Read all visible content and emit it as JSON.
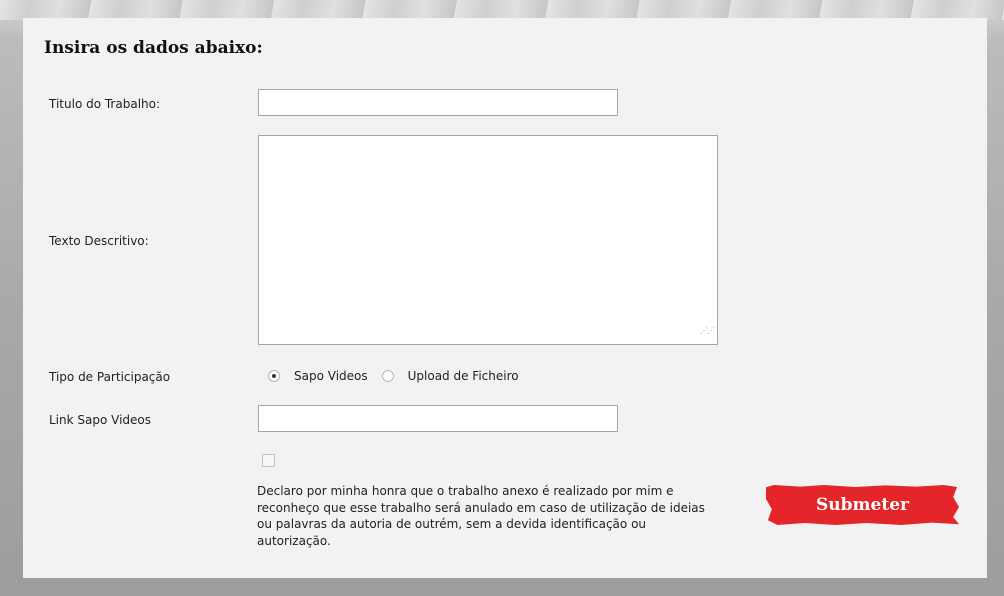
{
  "form": {
    "heading": "Insira os dados abaixo:",
    "title_label": "Titulo do Trabalho:",
    "title_value": "",
    "description_label": "Texto Descritivo:",
    "description_value": "",
    "participation_label": "Tipo de Participação",
    "participation_options": [
      {
        "label": "Sapo Videos",
        "selected": true
      },
      {
        "label": "Upload de Ficheiro",
        "selected": false
      }
    ],
    "link_label": "Link Sapo Videos",
    "link_value": "",
    "declaration_checked": false,
    "declaration_text": "Declaro por minha honra que o trabalho anexo é realizado por mim  e reconheço que esse trabalho será anulado em caso de utilização de ideias ou palavras da autoria de outrém, sem a devida identificação ou autorização.",
    "submit_label": "Submeter"
  },
  "colors": {
    "panel_background": "#f2f2f2",
    "submit_red": "#e4262a"
  }
}
